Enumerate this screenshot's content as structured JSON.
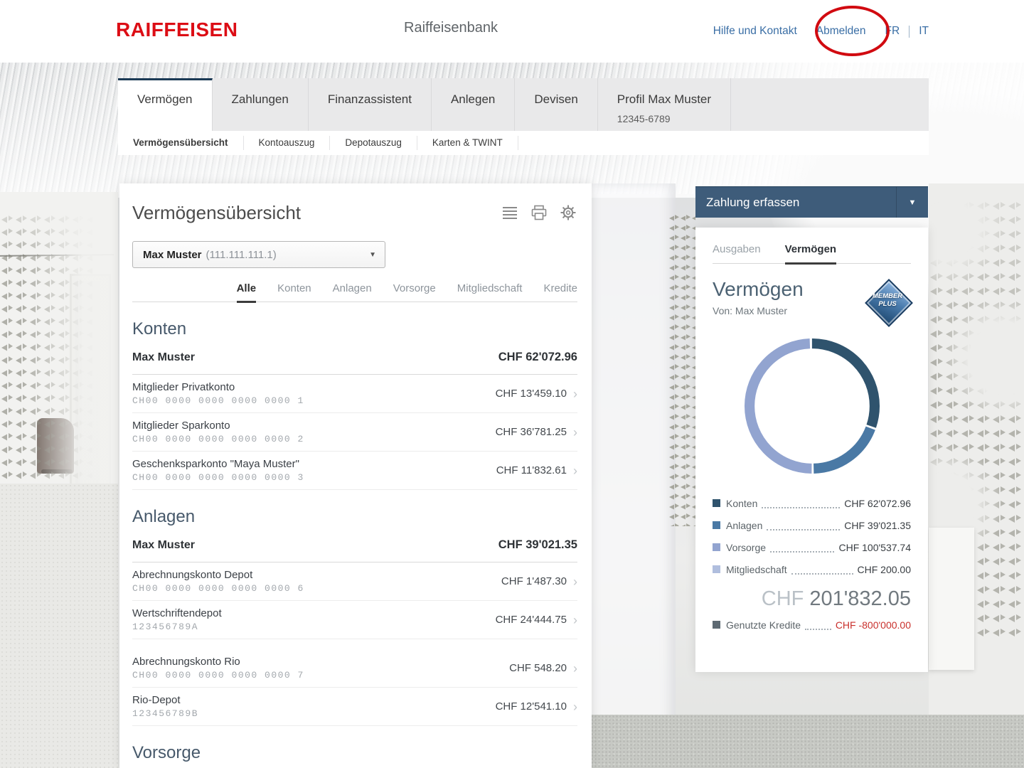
{
  "header": {
    "logo": "RAIFFEISEN",
    "bank_name": "Raiffeisenbank",
    "links": {
      "help": "Hilfe und Kontakt",
      "logout": "Abmelden",
      "fr": "FR",
      "it": "IT"
    }
  },
  "nav": {
    "tabs": [
      {
        "label": "Vermögen",
        "active": true
      },
      {
        "label": "Zahlungen"
      },
      {
        "label": "Finanzassistent"
      },
      {
        "label": "Anlegen"
      },
      {
        "label": "Devisen"
      },
      {
        "label": "Profil Max Muster",
        "sublabel": "12345-6789"
      }
    ],
    "subtabs": [
      {
        "label": "Vermögensübersicht",
        "active": true
      },
      {
        "label": "Kontoauszug"
      },
      {
        "label": "Depotauszug"
      },
      {
        "label": "Karten & TWINT"
      }
    ]
  },
  "main": {
    "title": "Vermögensübersicht",
    "customer_select": {
      "name": "Max Muster",
      "number": "(111.111.111.1)"
    },
    "filter_tabs": [
      "Alle",
      "Konten",
      "Anlagen",
      "Vorsorge",
      "Mitgliedschaft",
      "Kredite"
    ],
    "active_filter": "Alle",
    "sections": [
      {
        "heading": "Konten",
        "summary": {
          "name": "Max Muster",
          "amount": "CHF 62'072.96"
        },
        "rows": [
          {
            "name": "Mitglieder Privatkonto",
            "number": "CH00 0000 0000 0000 0000 1",
            "amount": "CHF 13'459.10"
          },
          {
            "name": "Mitglieder Sparkonto",
            "number": "CH00 0000 0000 0000 0000 2",
            "amount": "CHF 36'781.25"
          },
          {
            "name": "Geschenksparkonto \"Maya Muster\"",
            "number": "CH00 0000 0000 0000 0000 3",
            "amount": "CHF 11'832.61"
          }
        ]
      },
      {
        "heading": "Anlagen",
        "summary": {
          "name": "Max Muster",
          "amount": "CHF 39'021.35"
        },
        "rows": [
          {
            "name": "Abrechnungskonto Depot",
            "number": "CH00 0000 0000 0000 0000 6",
            "amount": "CHF 1'487.30"
          },
          {
            "name": "Wertschriftendepot",
            "number": "123456789A",
            "amount": "CHF 24'444.75"
          },
          {
            "name": "Abrechnungskonto Rio",
            "number": "CH00 0000 0000 0000 0000 7",
            "amount": "CHF 548.20"
          },
          {
            "name": "Rio-Depot",
            "number": "123456789B",
            "amount": "CHF 12'541.10"
          }
        ]
      },
      {
        "heading": "Vorsorge"
      }
    ]
  },
  "sidebar": {
    "payment_button": "Zahlung erfassen",
    "tabs": [
      {
        "label": "Ausgaben"
      },
      {
        "label": "Vermögen",
        "active": true
      }
    ],
    "panel_title": "Vermögen",
    "panel_subtitle": "Von: Max Muster",
    "badge": {
      "line1": "MEMBER",
      "line2": "PLUS"
    },
    "legend": [
      {
        "label": "Konten",
        "amount": "CHF 62'072.96"
      },
      {
        "label": "Anlagen",
        "amount": "CHF 39'021.35"
      },
      {
        "label": "Vorsorge",
        "amount": "CHF 100'537.74"
      },
      {
        "label": "Mitgliedschaft",
        "amount": "CHF 200.00"
      }
    ],
    "total": {
      "currency": "CHF",
      "amount": "201'832.05"
    },
    "credit": {
      "label": "Genutzte Kredite",
      "amount": "CHF -800'000.00"
    }
  },
  "chart_data": {
    "type": "pie",
    "subtype": "donut",
    "title": "Vermögen",
    "labels": [
      "Konten",
      "Anlagen",
      "Vorsorge",
      "Mitgliedschaft"
    ],
    "values": [
      62072.96,
      39021.35,
      100537.74,
      200.0
    ],
    "colors": [
      "#2f536d",
      "#4a79a5",
      "#92a4d0",
      "#b0bede"
    ],
    "total": 201832.05,
    "used_credit": -800000.0,
    "start_angle": "top",
    "direction": "clockwise",
    "legend_position": "bottom"
  },
  "icons": {
    "dropdown_caret": "▼",
    "payment_caret": "▼",
    "chevron_right": "›"
  },
  "colors": {
    "brand_red": "#dc0d15",
    "link_blue": "#3a6ea5",
    "button_blue": "#3e5c7a",
    "annotation_red": "#d10a10",
    "negative_red": "#c9302c",
    "credit_marker": "#5e6a73",
    "active_tab_border": "#1b3a55"
  }
}
